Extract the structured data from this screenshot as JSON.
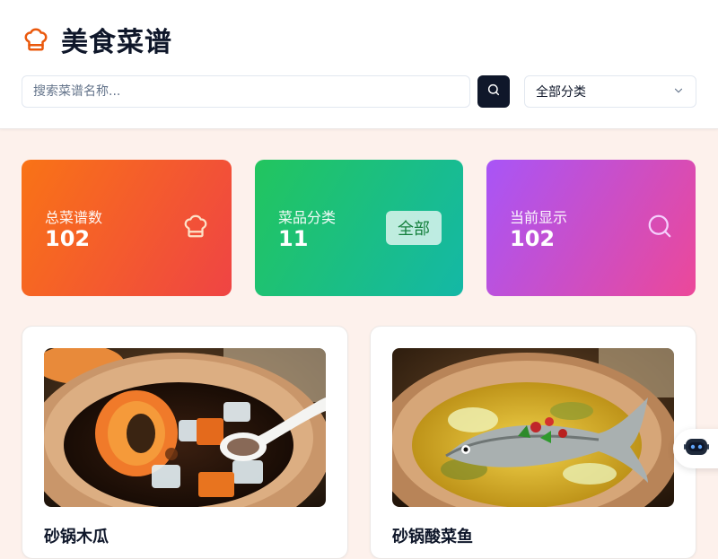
{
  "header": {
    "title": "美食菜谱",
    "logo_icon": "chef-hat-icon",
    "accent_color": "#ea580c"
  },
  "search": {
    "placeholder": "搜索菜谱名称...",
    "value": "",
    "button_icon": "search-icon"
  },
  "category_filter": {
    "selected": "全部分类",
    "icon": "chevron-down-icon"
  },
  "stats": [
    {
      "label": "总菜谱数",
      "value": "102",
      "icon": "chef-hat-icon"
    },
    {
      "label": "菜品分类",
      "value": "11",
      "badge": "全部"
    },
    {
      "label": "当前显示",
      "value": "102",
      "icon": "search-icon"
    }
  ],
  "recipes": [
    {
      "name": "砂锅木瓜",
      "image": "papaya-dessert-in-clay-pot"
    },
    {
      "name": "砂锅酸菜鱼",
      "image": "pickled-cabbage-fish-in-clay-pot"
    }
  ],
  "assistant": {
    "icon": "robot-icon"
  }
}
